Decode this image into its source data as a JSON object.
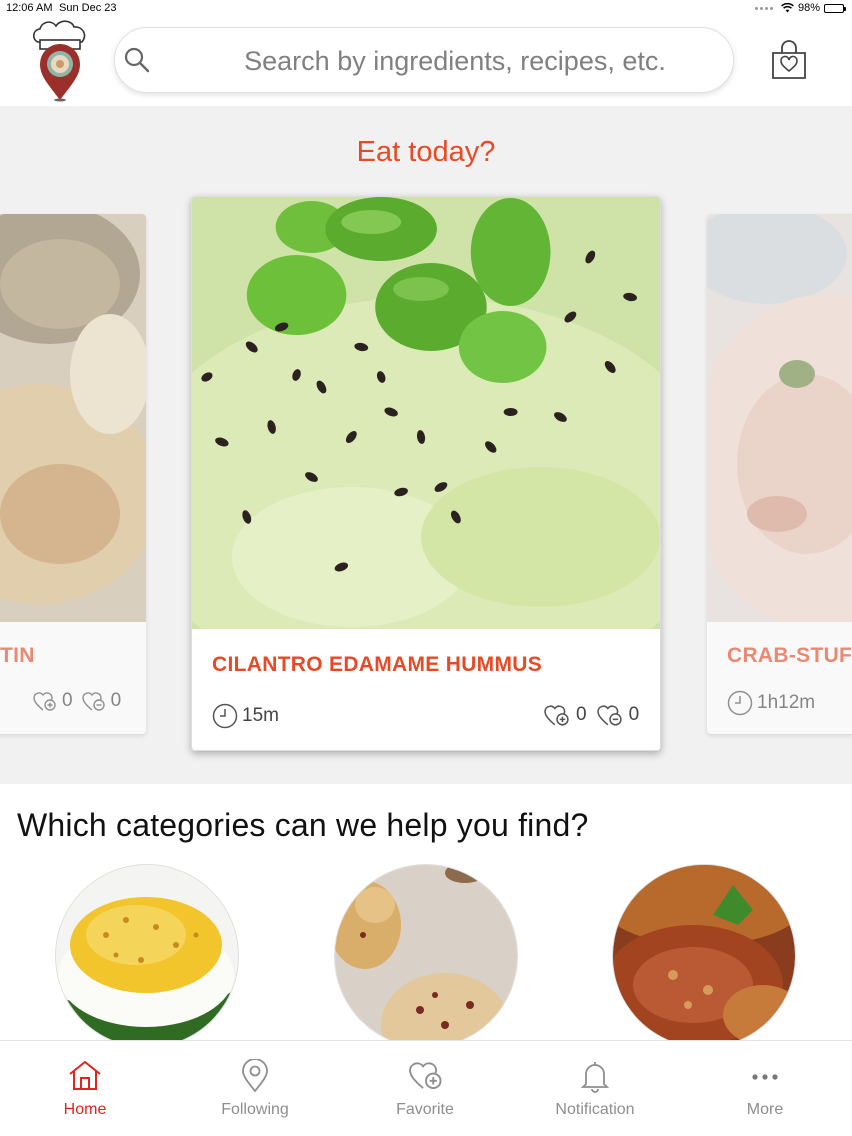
{
  "status_bar": {
    "time": "12:06 AM",
    "date": "Sun Dec 23",
    "battery": "98%",
    "battery_level": 0.98
  },
  "header": {
    "search_placeholder": "Search by ingredients, recipes, etc.",
    "icons": {
      "logo": "chef-hat-location-pin-logo",
      "search": "search-icon",
      "bag": "shopping-bag-heart-icon"
    }
  },
  "hero": {
    "title": "Eat today?",
    "cards": [
      {
        "name": "TIN",
        "time": "",
        "likes": "0",
        "dislikes": "0"
      },
      {
        "name": "CILANTRO EDAMAME HUMMUS",
        "time": "15m",
        "likes": "0",
        "dislikes": "0"
      },
      {
        "name": "CRAB-STUF",
        "time": "1h12m",
        "likes": "",
        "dislikes": ""
      }
    ]
  },
  "categories": {
    "title": "Which categories can we help you find?",
    "items": [
      {
        "image": "deviled-eggs-photo"
      },
      {
        "image": "cookies-photo"
      },
      {
        "image": "pastry-empanada-photo"
      }
    ]
  },
  "tabbar": {
    "tabs": [
      {
        "label": "Home",
        "icon": "home-icon",
        "active": true
      },
      {
        "label": "Following",
        "icon": "location-pin-icon",
        "active": false
      },
      {
        "label": "Favorite",
        "icon": "heart-plus-icon",
        "active": false
      },
      {
        "label": "Notification",
        "icon": "bell-icon",
        "active": false
      },
      {
        "label": "More",
        "icon": "more-dots-icon",
        "active": false
      }
    ]
  },
  "colors": {
    "accent": "#e54b26",
    "active_tab": "#e1251b",
    "hero_bg": "#f1f1f1"
  }
}
